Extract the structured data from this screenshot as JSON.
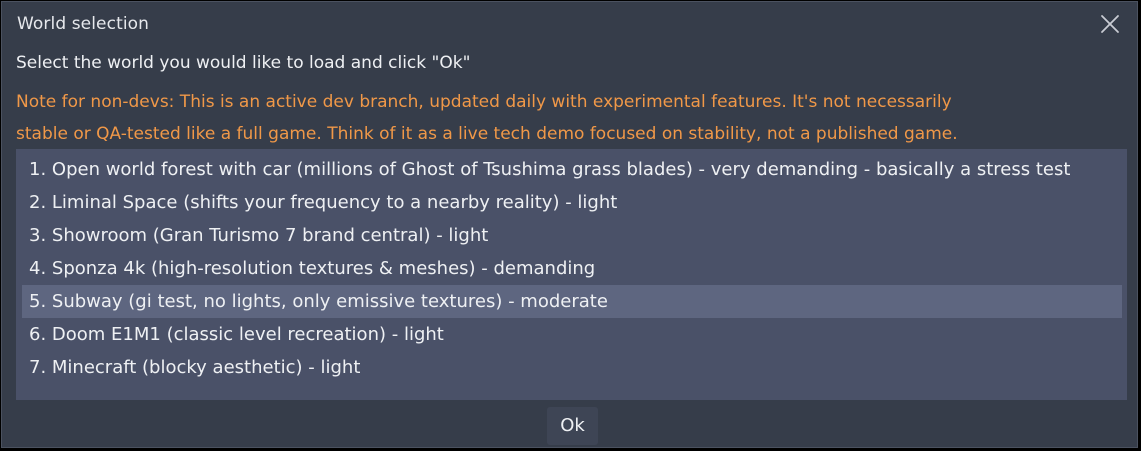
{
  "dialog": {
    "title": "World selection",
    "close_icon": "close-icon",
    "prompt": "Select the world you would like to load and click \"Ok\"",
    "note_line1": "Note for non-devs: This is an active dev branch, updated daily with experimental features. It's not necessarily",
    "note_line2": "stable or QA-tested like a full game. Think of it as a live tech demo focused on stability, not a published game.",
    "note_color": "#f09848",
    "selected_index": 4,
    "worlds": [
      {
        "label": "1. Open world forest with car (millions of Ghost of Tsushima grass blades) - very demanding - basically a stress test"
      },
      {
        "label": "2. Liminal Space (shifts your frequency to a nearby reality) - light"
      },
      {
        "label": "3. Showroom (Gran Turismo 7 brand central) - light"
      },
      {
        "label": "4. Sponza 4k (high-resolution textures & meshes) - demanding"
      },
      {
        "label": "5. Subway (gi test, no lights, only emissive textures) - moderate"
      },
      {
        "label": "6. Doom E1M1 (classic level recreation) - light"
      },
      {
        "label": "7. Minecraft (blocky aesthetic) - light"
      }
    ],
    "ok_label": "Ok"
  }
}
